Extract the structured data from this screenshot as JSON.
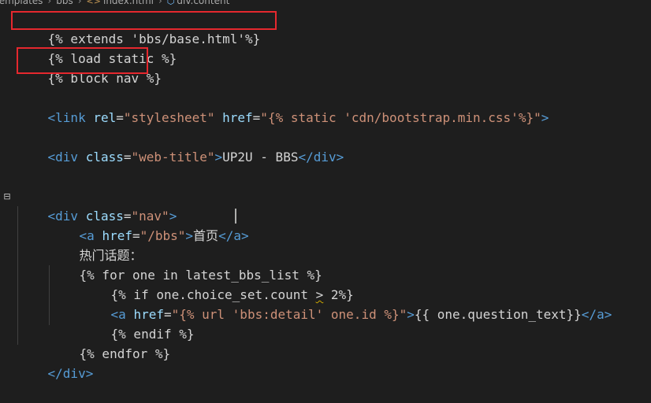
{
  "breadcrumb": {
    "items": [
      "templates",
      "bbs",
      "index.html",
      "div.content"
    ],
    "separator": "›"
  },
  "code": {
    "l1": "{% extends 'bbs/base.html'%}",
    "l2": "{% load static %}",
    "l3": "{% block nav %}",
    "l4": {
      "tag_open": "<link",
      "attr1": "rel",
      "val1": "\"stylesheet\"",
      "attr2": "href",
      "val2": "\"{% static 'cdn/bootstrap.min.css'%}\"",
      "tag_close": ">"
    },
    "l5": {
      "tag_open": "<div",
      "attr": "class",
      "val": "\"web-title\"",
      "gt": ">",
      "text": "UP2U - BBS",
      "end": "</div>"
    },
    "l6": {
      "tag_open": "<div",
      "attr": "class",
      "val": "\"nav\"",
      "gt": ">"
    },
    "l7": {
      "tag_open": "<a",
      "attr": "href",
      "val": "\"/bbs\"",
      "gt": ">",
      "text": "首页",
      "end": "</a>"
    },
    "l8": "热门话题：",
    "l9": "{% for one in latest_bbs_list %}",
    "l10": {
      "pre": "{% if one.choice_set.count ",
      "op": ">",
      "post": " 2%}"
    },
    "l11": {
      "tag_open": "<a",
      "attr": "href",
      "val_a": "\"{% url 'bbs:detail' ",
      "val_b": "one.id %}\"",
      "gt": ">",
      "text": "{{ one.question_text}}",
      "end": "</a>"
    },
    "l12": "{% endif %}",
    "l13": "{% endfor %}",
    "l14": "</div>"
  },
  "colors": {
    "background": "#1e1e1e",
    "tag": "#569cd6",
    "attribute": "#9cdcfe",
    "string": "#ce9178",
    "text": "#d4d4d4",
    "highlight": "#e5282e"
  }
}
